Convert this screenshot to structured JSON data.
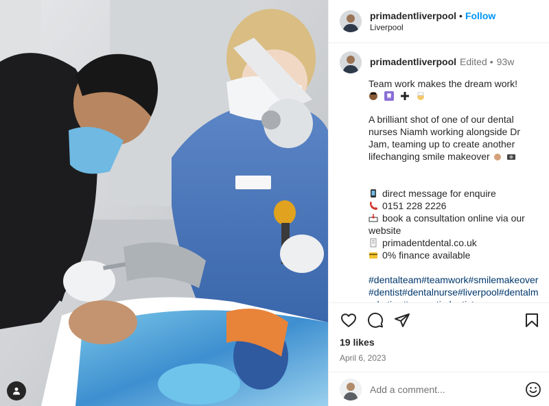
{
  "post": {
    "username": "primadentliverpool",
    "follow_label": "Follow",
    "location": "Liverpool",
    "edited_label": "Edited",
    "time_ago": "93w",
    "caption_title": "Team work makes the dream work!",
    "caption_body": "A brilliant shot of one of our dental nurses Niamh working alongside Dr Jam, teaming up to create another lifechanging smile makeover",
    "contact_message": "direct message for enquire",
    "contact_phone": "0151 228 2226",
    "contact_book": "book a consultation online via our website",
    "contact_site": "primadentdental.co.uk",
    "contact_finance": "0% finance available",
    "hashtags": "#dentalteam#teamwork#smilemakeover#dentist#dentalnurse#liverpool#dentalmarketing#cosmeticdentistry",
    "likes": "19 likes",
    "date": "April 6, 2023",
    "comment_placeholder": "Add a comment..."
  },
  "icons": {
    "like": "heart-icon",
    "comment": "comment-icon",
    "share": "paper-plane-icon",
    "save": "bookmark-icon",
    "emoji": "smiley-icon",
    "tag": "person-tag-icon"
  },
  "colors": {
    "follow": "#0095f6",
    "hashtag": "#00376b",
    "muted": "#737373"
  }
}
